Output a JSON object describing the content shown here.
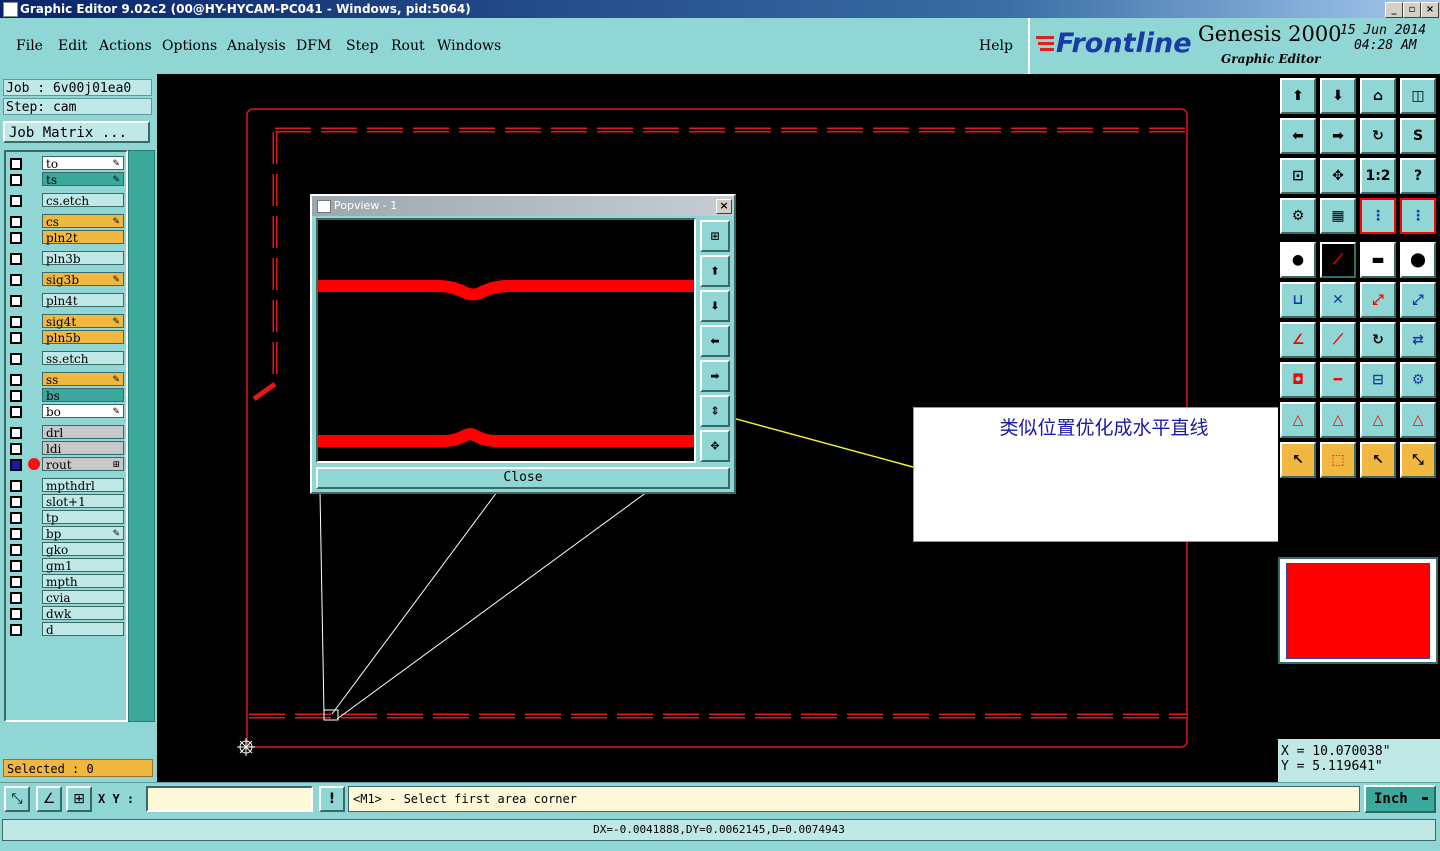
{
  "window": {
    "title": "Graphic Editor 9.02c2 (00@HY-HYCAM-PC041 - Windows, pid:5064)"
  },
  "menu": [
    "File",
    "Edit",
    "Actions",
    "Options",
    "Analysis",
    "DFM",
    "Step",
    "Rout",
    "Windows"
  ],
  "help_label": "Help",
  "brand": {
    "logo": "Frontline",
    "product": "Genesis 2000",
    "subtitle": "Graphic Editor",
    "date": "15 Jun 2014",
    "time": "04:28 AM"
  },
  "job": {
    "label": "Job : 6v00j01ea0",
    "step": "Step: cam",
    "matrix_button": "Job Matrix ..."
  },
  "layers": [
    {
      "name": "to",
      "color": "#ffffff",
      "mark": "✎"
    },
    {
      "name": "ts",
      "color": "#3aa89a",
      "mark": "✎"
    },
    {
      "name": "cs.etch",
      "color": "#bfe8e6",
      "mark": ""
    },
    {
      "name": "cs",
      "color": "#f0b840",
      "mark": "✎"
    },
    {
      "name": "pln2t",
      "color": "#f0b840",
      "mark": ""
    },
    {
      "name": "pln3b",
      "color": "#bfe8e6",
      "mark": ""
    },
    {
      "name": "sig3b",
      "color": "#f0b840",
      "mark": "✎"
    },
    {
      "name": "pln4t",
      "color": "#bfe8e6",
      "mark": ""
    },
    {
      "name": "sig4t",
      "color": "#f0b840",
      "mark": "✎"
    },
    {
      "name": "pln5b",
      "color": "#f0b840",
      "mark": ""
    },
    {
      "name": "ss.etch",
      "color": "#bfe8e6",
      "mark": ""
    },
    {
      "name": "ss",
      "color": "#f0b840",
      "mark": "✎"
    },
    {
      "name": "bs",
      "color": "#3aa89a",
      "mark": ""
    },
    {
      "name": "bo",
      "color": "#ffffff",
      "mark": "✎"
    },
    {
      "name": "drl",
      "color": "#c8c8c8",
      "mark": ""
    },
    {
      "name": "ldi",
      "color": "#c8c8c8",
      "mark": ""
    },
    {
      "name": "rout",
      "color": "#c8c8c8",
      "mark": "⊞"
    },
    {
      "name": "mpthdrl",
      "color": "#bfe8e6",
      "mark": ""
    },
    {
      "name": "slot+1",
      "color": "#bfe8e6",
      "mark": ""
    },
    {
      "name": "tp",
      "color": "#bfe8e6",
      "mark": ""
    },
    {
      "name": "bp",
      "color": "#bfe8e6",
      "mark": "✎"
    },
    {
      "name": "gko",
      "color": "#bfe8e6",
      "mark": ""
    },
    {
      "name": "gm1",
      "color": "#bfe8e6",
      "mark": ""
    },
    {
      "name": "mpth",
      "color": "#bfe8e6",
      "mark": ""
    },
    {
      "name": "cvia",
      "color": "#bfe8e6",
      "mark": ""
    },
    {
      "name": "dwk",
      "color": "#bfe8e6",
      "mark": ""
    },
    {
      "name": "d",
      "color": "#bfe8e6",
      "mark": ""
    }
  ],
  "selected": "Selected : 0",
  "popup": {
    "title": "Popview - 1",
    "close": "Close"
  },
  "annotation": "类似位置优化成水平直线",
  "toolbar_labels": {
    "scale": "1:2",
    "help": "?"
  },
  "coords": {
    "x": "X = 10.070038\"",
    "y": "Y = 5.119641\""
  },
  "bottom": {
    "xy_label": "X Y :",
    "xy_value": "",
    "prompt": "<M1> - Select first area corner",
    "units": "Inch"
  },
  "status": "DX=-0.0041888,DY=0.0062145,D=0.0074943"
}
